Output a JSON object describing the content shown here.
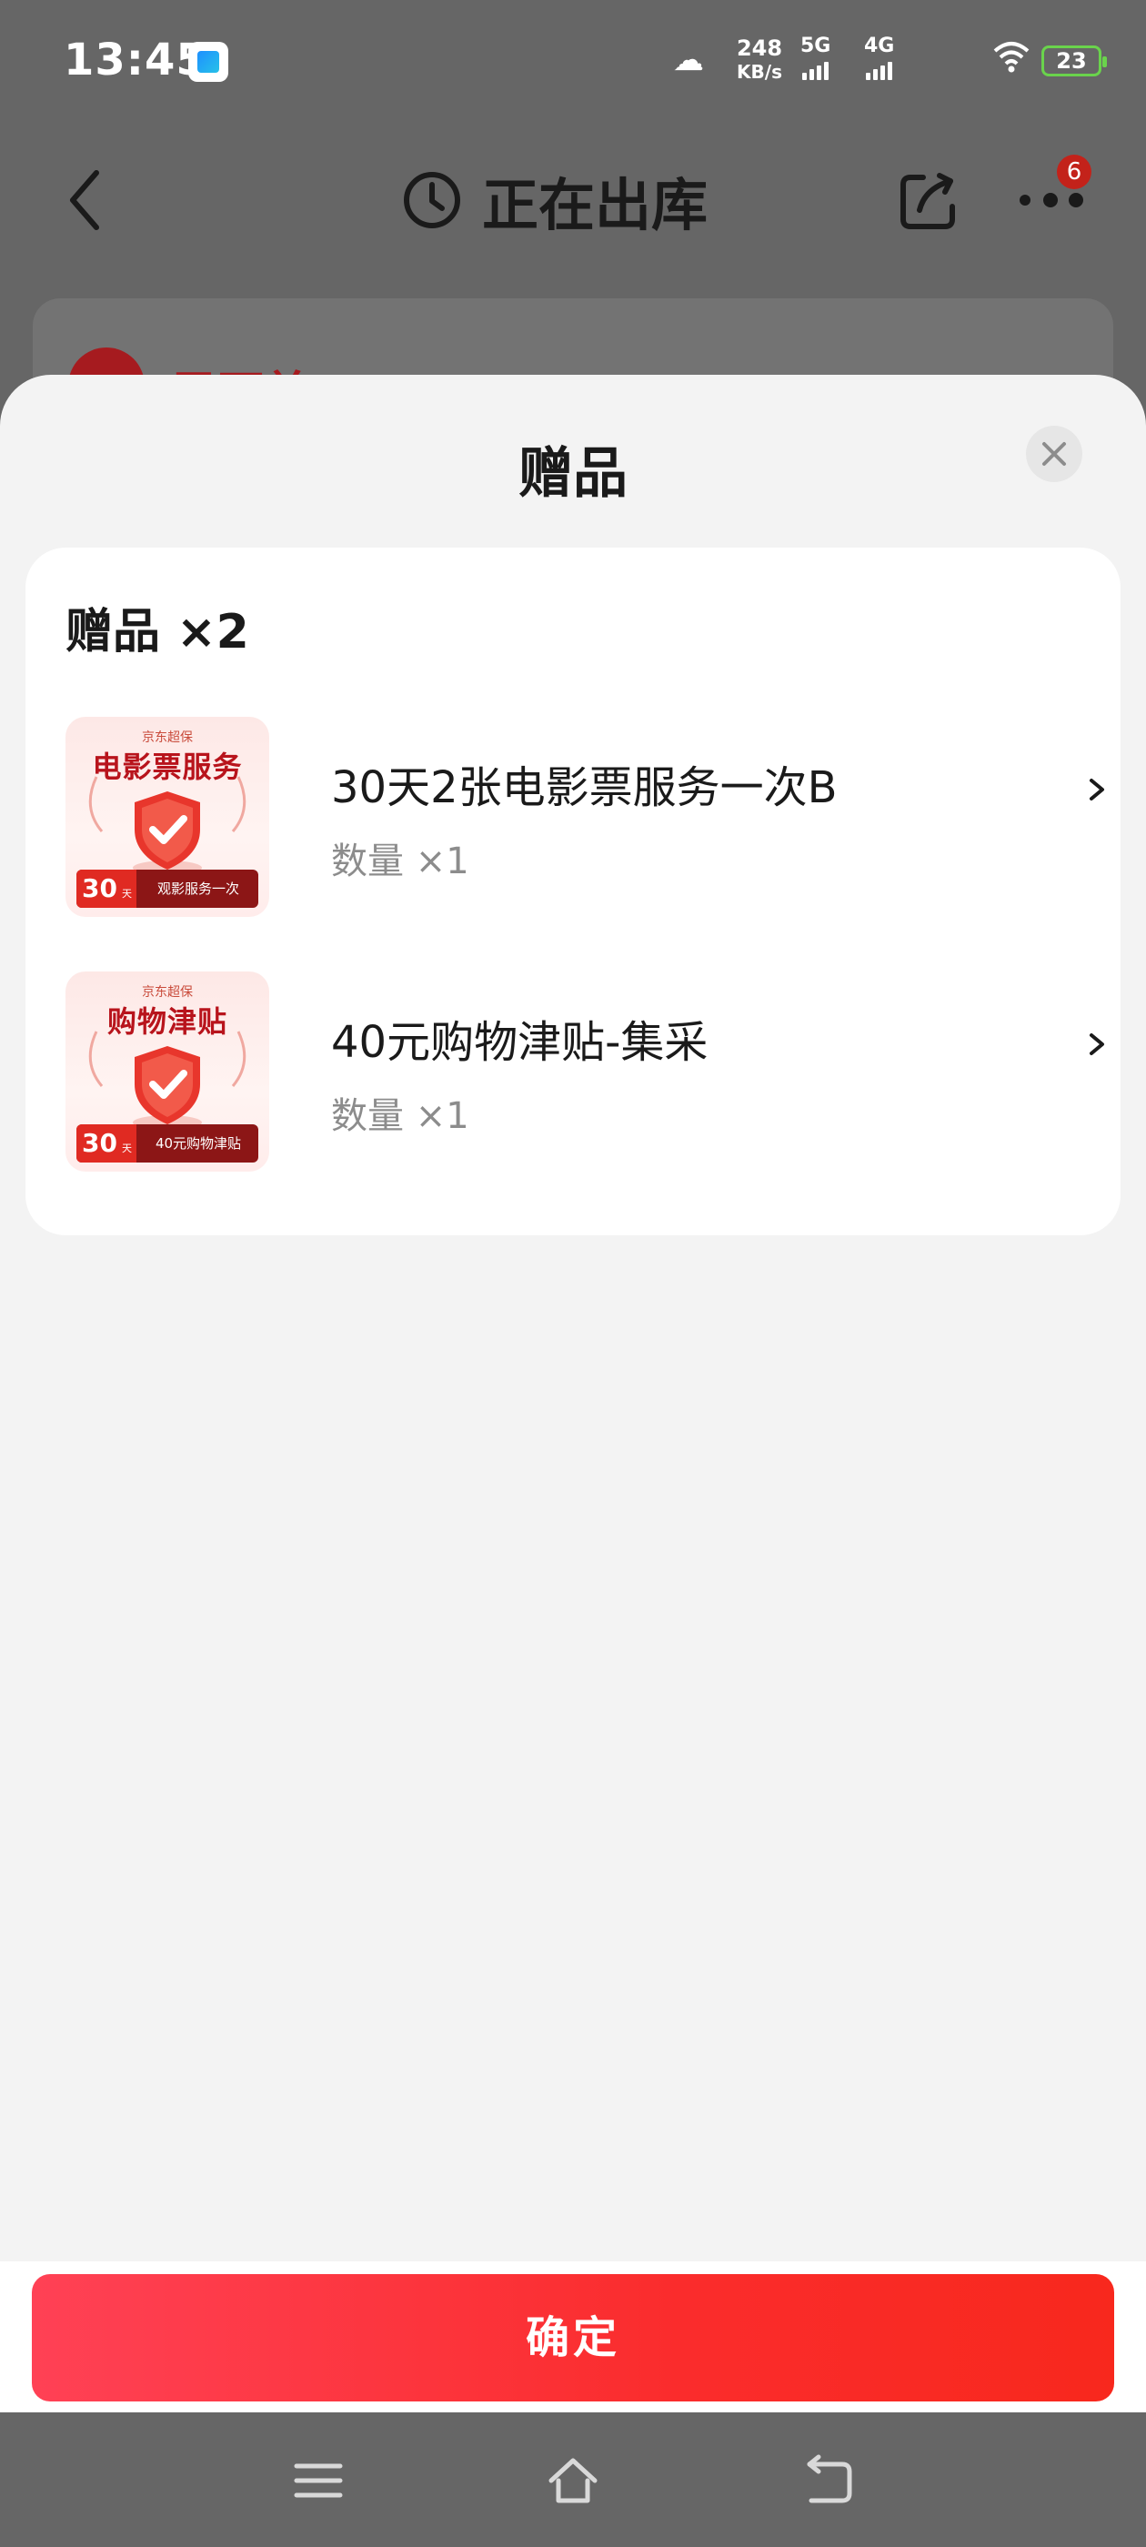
{
  "status_bar": {
    "time": "13:45",
    "net_speed_value": "248",
    "net_speed_unit": "KB/s",
    "signal_1_label": "5G",
    "signal_2_label": "4G",
    "battery_level": "23",
    "icons": [
      "app-notification-icon",
      "cloud-icon",
      "signal-5g-icon",
      "signal-4g-icon",
      "wifi-icon",
      "battery-icon"
    ]
  },
  "header": {
    "title": "正在出库",
    "more_badge": "6",
    "icons": [
      "back-chevron-icon",
      "clock-icon",
      "share-icon",
      "more-dots-icon"
    ]
  },
  "background_card": {
    "text": "已下单"
  },
  "sheet": {
    "title": "赠品",
    "close_icon": "close-icon",
    "card_title": "赠品 ×2",
    "items": [
      {
        "name": "30天2张电影票服务一次B",
        "quantity": "数量 ×1",
        "thumb_brand": "京东超保",
        "thumb_title": "电影票服务",
        "thumb_days": "30",
        "thumb_days_unit": "天",
        "thumb_banner": "观影服务一次"
      },
      {
        "name": "40元购物津贴-集采",
        "quantity": "数量 ×1",
        "thumb_brand": "京东超保",
        "thumb_title": "购物津贴",
        "thumb_days": "30",
        "thumb_days_unit": "天",
        "thumb_banner": "40元购物津贴"
      }
    ]
  },
  "footer": {
    "confirm_label": "确定"
  },
  "system_nav": {
    "icons": [
      "menu-icon",
      "home-icon",
      "back-icon"
    ]
  },
  "colors": {
    "accent_red": "#f8281d",
    "button_gradient_start": "#ff4155",
    "overlay_gray": "#666666",
    "sheet_bg": "#f3f3f3",
    "battery_green": "#6ad34c"
  }
}
